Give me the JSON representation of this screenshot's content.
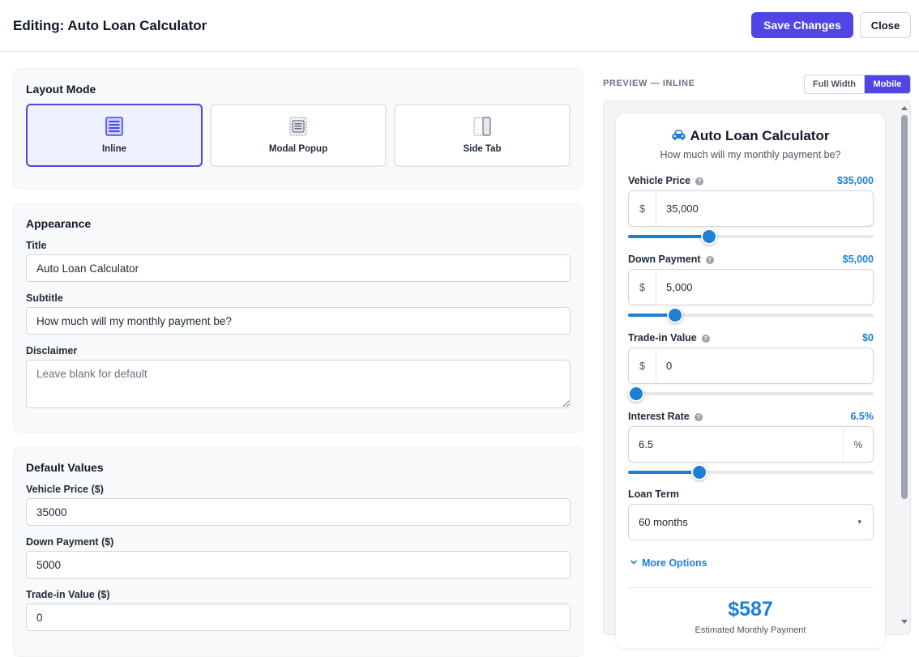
{
  "header": {
    "title": "Editing: Auto Loan Calculator",
    "save_label": "Save Changes",
    "close_label": "Close"
  },
  "layout_mode": {
    "title": "Layout Mode",
    "options": [
      {
        "label": "Inline",
        "icon": "inline-layout-icon",
        "selected": true
      },
      {
        "label": "Modal Popup",
        "icon": "modal-layout-icon",
        "selected": false
      },
      {
        "label": "Side Tab",
        "icon": "side-tab-layout-icon",
        "selected": false
      }
    ]
  },
  "appearance": {
    "title": "Appearance",
    "title_label": "Title",
    "title_value": "Auto Loan Calculator",
    "subtitle_label": "Subtitle",
    "subtitle_value": "How much will my monthly payment be?",
    "disclaimer_label": "Disclaimer",
    "disclaimer_placeholder": "Leave blank for default"
  },
  "defaults": {
    "title": "Default Values",
    "vehicle_price_label": "Vehicle Price ($)",
    "vehicle_price_value": "35000",
    "down_payment_label": "Down Payment ($)",
    "down_payment_value": "5000",
    "trade_in_label": "Trade-in Value ($)",
    "trade_in_value": "0"
  },
  "preview": {
    "label": "PREVIEW — INLINE",
    "toggle": [
      "Full Width",
      "Mobile"
    ],
    "active_toggle": "Mobile",
    "widget": {
      "icon": "car-icon",
      "title": "Auto Loan Calculator",
      "subtitle": "How much will my monthly payment be?",
      "help_glyph": "?",
      "currency_prefix": "$",
      "percent_suffix": "%",
      "fields": {
        "vehicle_price": {
          "label": "Vehicle Price",
          "display": "$35,000",
          "input": "35,000",
          "slider_fraction": 0.33
        },
        "down_payment": {
          "label": "Down Payment",
          "display": "$5,000",
          "input": "5,000",
          "slider_fraction": 0.19
        },
        "trade_in": {
          "label": "Trade-in Value",
          "display": "$0",
          "input": "0",
          "slider_fraction": 0.0
        },
        "interest_rate": {
          "label": "Interest Rate",
          "display": "6.5%",
          "input": "6.5",
          "slider_fraction": 0.29
        }
      },
      "loan_term_label": "Loan Term",
      "loan_term_value": "60 months",
      "more_options": "More Options",
      "result_value": "$587",
      "result_label": "Estimated Monthly Payment"
    }
  },
  "colors": {
    "primary": "#4f46e5",
    "accent_blue": "#1d7fd6",
    "panel_bg": "#f8f9fa"
  }
}
